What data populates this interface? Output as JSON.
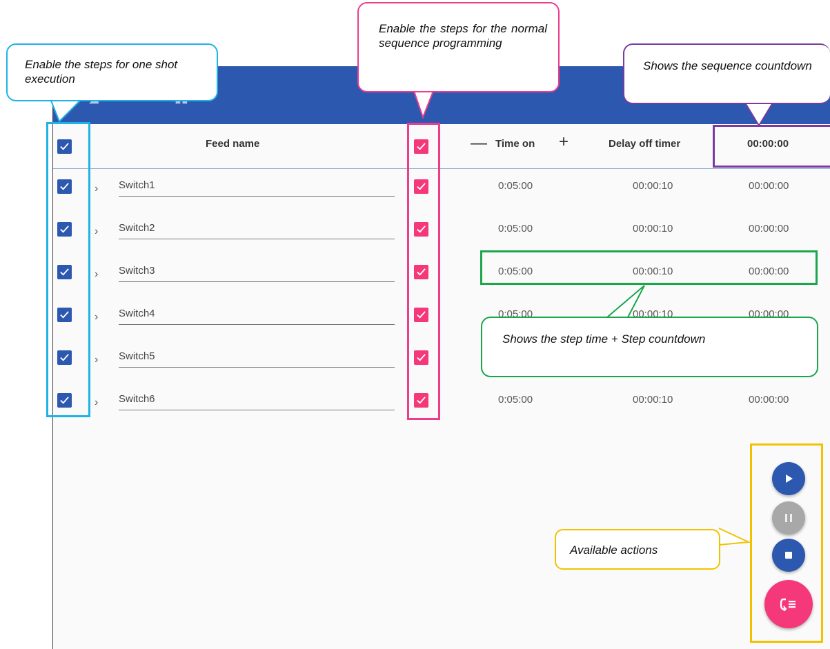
{
  "header": {
    "feed_name": "Feed name",
    "time_on": "Time on",
    "delay_off_timer": "Delay off timer",
    "sequence_countdown": "00:00:00",
    "minus_symbol": "—",
    "plus_symbol": "+"
  },
  "rows": [
    {
      "name": "Switch1",
      "time_on": "0:05:00",
      "delay": "00:00:10",
      "countdown": "00:00:00"
    },
    {
      "name": "Switch2",
      "time_on": "0:05:00",
      "delay": "00:00:10",
      "countdown": "00:00:00"
    },
    {
      "name": "Switch3",
      "time_on": "0:05:00",
      "delay": "00:00:10",
      "countdown": "00:00:00"
    },
    {
      "name": "Switch4",
      "time_on": "0:05:00",
      "delay": "00:00:10",
      "countdown": "00:00:00"
    },
    {
      "name": "Switch5",
      "time_on": "",
      "delay": "",
      "countdown": ""
    },
    {
      "name": "Switch6",
      "time_on": "0:05:00",
      "delay": "00:00:10",
      "countdown": "00:00:00"
    }
  ],
  "callouts": {
    "one_shot": "Enable the steps for one shot execution",
    "normal_sequence": "Enable the steps for the normal sequence programming",
    "sequence_countdown": "Shows the sequence countdown",
    "step_time": "Shows the step time + Step countdown",
    "actions": "Available actions"
  },
  "actions": [
    "play-icon",
    "pause-icon",
    "stop-icon",
    "sequence-list-icon"
  ],
  "colors": {
    "primary": "#2d58b0",
    "accent": "#f4387a",
    "highlight_blue": "#1fb2e6",
    "highlight_pink": "#ec3d8d",
    "highlight_purple": "#7a3aa0",
    "highlight_green": "#1aa64a",
    "highlight_yellow": "#f2c200"
  }
}
